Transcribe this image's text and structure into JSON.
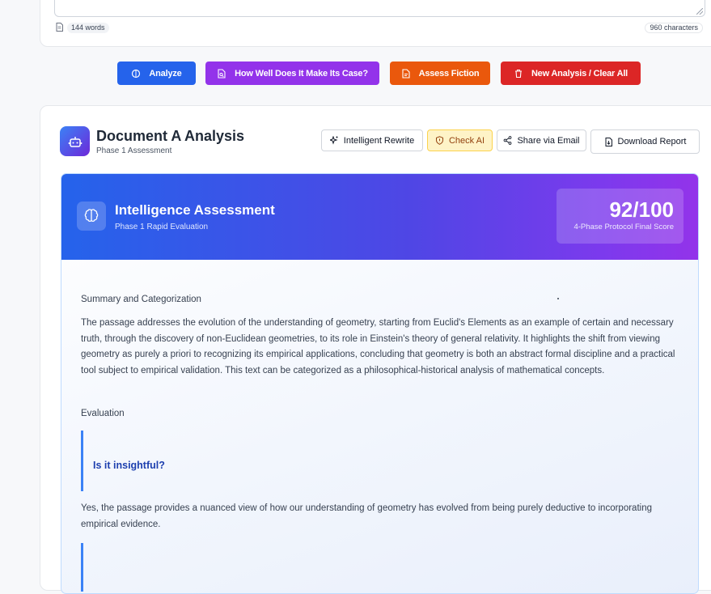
{
  "input": {
    "word_count": "144 words",
    "char_count": "960 characters"
  },
  "actions": {
    "analyze": "Analyze",
    "case": "How Well Does It Make Its Case?",
    "fiction": "Assess Fiction",
    "clear": "New Analysis / Clear All"
  },
  "analysis": {
    "title": "Document A Analysis",
    "subtitle": "Phase 1 Assessment",
    "tools": {
      "rewrite": "Intelligent Rewrite",
      "check_ai": "Check AI",
      "share": "Share via Email",
      "download": "Download Report"
    }
  },
  "assessment": {
    "title": "Intelligence Assessment",
    "subtitle": "Phase 1 Rapid Evaluation",
    "score": "92/100",
    "score_caption": "4-Phase Protocol Final Score",
    "summary_heading": "Summary and Categorization",
    "summary_text": "The passage addresses the evolution of the understanding of geometry, starting from Euclid's Elements as an example of certain and necessary truth, through the discovery of non-Euclidean geometries, to its role in Einstein's theory of general relativity. It highlights the shift from viewing geometry as purely a priori to recognizing its empirical applications, concluding that geometry is both an abstract formal discipline and a practical tool subject to empirical validation. This text can be categorized as a philosophical-historical analysis of mathematical concepts.",
    "evaluation_heading": "Evaluation",
    "question": "Is it insightful?",
    "answer": "Yes, the passage provides a nuanced view of how our understanding of geometry has evolved from being purely deductive to incorporating empirical evidence."
  },
  "colors": {
    "analyze": "#2563eb",
    "case": "#9333ea",
    "fiction": "#ea580c",
    "clear": "#dc2626",
    "accent_blue": "#3b82f6"
  }
}
